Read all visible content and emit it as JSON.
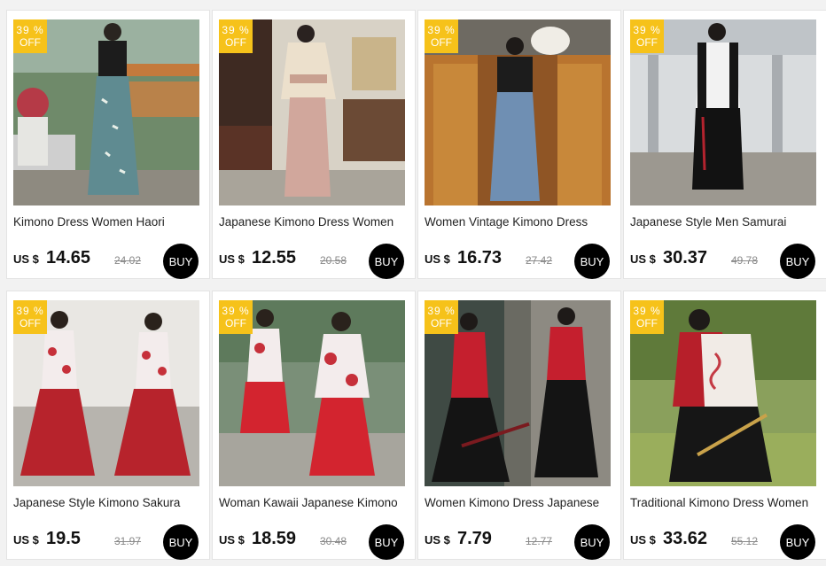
{
  "products": [
    {
      "badge_pct": "39 %",
      "badge_off": "OFF",
      "title": "Kimono Dress Women Haori",
      "currency": "US $",
      "price": "14.65",
      "original_price": "24.02",
      "buy_label": "BUY",
      "image_desc": "woman-teal-crane-kimono-skirt"
    },
    {
      "badge_pct": "39 %",
      "badge_off": "OFF",
      "title": "Japanese Kimono Dress Women",
      "currency": "US $",
      "price": "12.55",
      "original_price": "20.58",
      "buy_label": "BUY",
      "image_desc": "woman-pink-kimono-dress"
    },
    {
      "badge_pct": "39 %",
      "badge_off": "OFF",
      "title": "Women Vintage Kimono Dress",
      "currency": "US $",
      "price": "16.73",
      "original_price": "27.42",
      "buy_label": "BUY",
      "image_desc": "woman-black-blue-kimono-fan"
    },
    {
      "badge_pct": "39 %",
      "badge_off": "OFF",
      "title": "Japanese Style Men Samurai",
      "currency": "US $",
      "price": "30.37",
      "original_price": "49.78",
      "buy_label": "BUY",
      "image_desc": "person-black-samurai-kimono"
    },
    {
      "badge_pct": "39 %",
      "badge_off": "OFF",
      "title": "Japanese Style Kimono Sakura",
      "currency": "US $",
      "price": "19.5",
      "original_price": "31.97",
      "buy_label": "BUY",
      "image_desc": "two-women-red-sakura-kimono"
    },
    {
      "badge_pct": "39 %",
      "badge_off": "OFF",
      "title": "Woman Kawaii Japanese Kimono",
      "currency": "US $",
      "price": "18.59",
      "original_price": "30.48",
      "buy_label": "BUY",
      "image_desc": "two-women-kawaii-red-kimono"
    },
    {
      "badge_pct": "39 %",
      "badge_off": "OFF",
      "title": "Women Kimono Dress Japanese",
      "currency": "US $",
      "price": "7.79",
      "original_price": "12.77",
      "buy_label": "BUY",
      "image_desc": "two-women-red-black-kimono"
    },
    {
      "badge_pct": "39 %",
      "badge_off": "OFF",
      "title": "Traditional Kimono Dress Women",
      "currency": "US $",
      "price": "33.62",
      "original_price": "55.12",
      "buy_label": "BUY",
      "image_desc": "woman-traditional-kimono-sword"
    }
  ],
  "colors": {
    "badge": "#f6c21a",
    "buy": "#000000",
    "background": "#f2f2f2"
  }
}
